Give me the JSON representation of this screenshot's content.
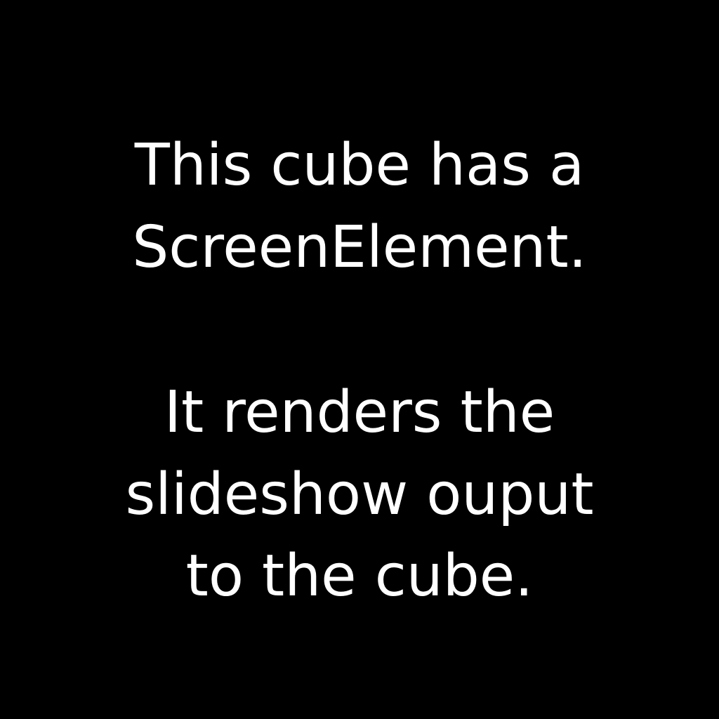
{
  "slide": {
    "background": "#000000",
    "text_color": "#ffffff",
    "paragraph_1": {
      "line_1": "This cube has a",
      "line_2": "ScreenElement."
    },
    "paragraph_2": {
      "line_1": "It renders the",
      "line_2": "slideshow ouput",
      "line_3": "to the cube."
    }
  }
}
